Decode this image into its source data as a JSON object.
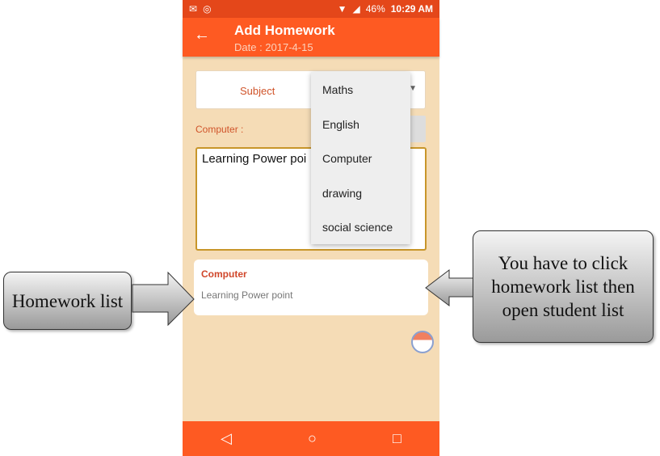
{
  "status_bar": {
    "battery": "46%",
    "time": "10:29 AM"
  },
  "app_bar": {
    "title": "Add Homework",
    "date": "Date : 2017-4-15"
  },
  "form": {
    "subject_label": "Subject",
    "selected_label": "Computer :",
    "homework_text": "Learning Power poi"
  },
  "dropdown": {
    "options": [
      "Maths",
      "English",
      "Computer",
      "drawing",
      "social science"
    ]
  },
  "homework_list": [
    {
      "subject": "Computer",
      "description": "Learning Power point"
    }
  ],
  "callouts": {
    "left": "Homework list",
    "right": "You have to click homework list then open student list"
  },
  "colors": {
    "accent": "#fe5a22",
    "background": "#f5dcb6"
  }
}
